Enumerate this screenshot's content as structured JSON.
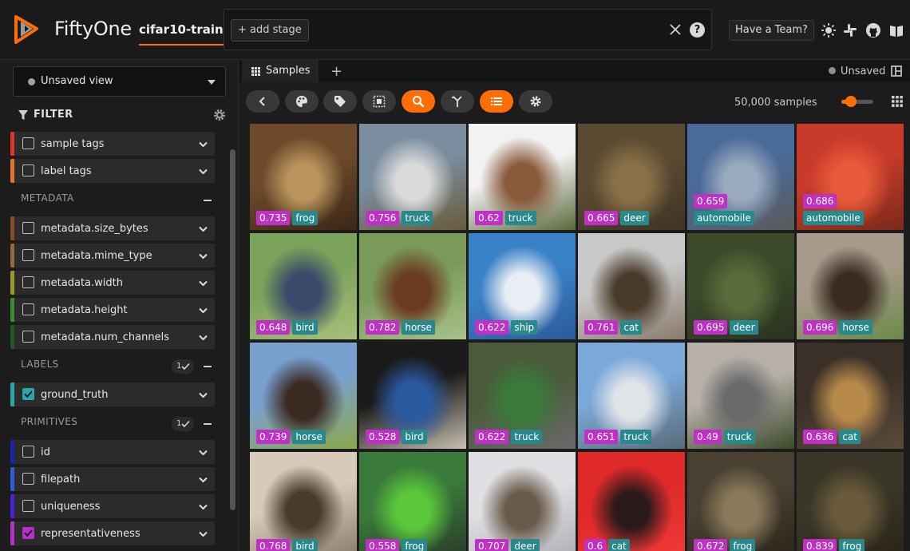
{
  "header": {
    "brand": "FiftyOne",
    "dataset": "cifar10-train",
    "add_stage": "+ add stage",
    "help": "?",
    "team_button": "Have a Team?",
    "icons": [
      "sun-icon",
      "slack-icon",
      "github-icon",
      "book-icon"
    ]
  },
  "sidebar": {
    "view_select": "Unsaved view",
    "filter_title": "FILTER",
    "sections": {
      "metadata": "METADATA",
      "labels": "LABELS",
      "labels_badge": "1",
      "primitives": "PRIMITIVES",
      "primitives_badge": "1"
    },
    "rows": [
      {
        "label": "sample tags",
        "color": "#e1352b",
        "checked": false
      },
      {
        "label": "label tags",
        "color": "#e8722b",
        "checked": false
      },
      {
        "label": "metadata.size_bytes",
        "color": "#8a4a22",
        "checked": false
      },
      {
        "label": "metadata.mime_type",
        "color": "#8e6a3c",
        "checked": false
      },
      {
        "label": "metadata.width",
        "color": "#9a9a26",
        "checked": false
      },
      {
        "label": "metadata.height",
        "color": "#3a8c2e",
        "checked": false
      },
      {
        "label": "metadata.num_channels",
        "color": "#1e5a22",
        "checked": false
      },
      {
        "label": "ground_truth",
        "color": "#2aa5a8",
        "checked": true
      },
      {
        "label": "id",
        "color": "#1a23b0",
        "checked": false
      },
      {
        "label": "filepath",
        "color": "#2d5ae0",
        "checked": false
      },
      {
        "label": "uniqueness",
        "color": "#4a22d8",
        "checked": false
      },
      {
        "label": "representativeness",
        "color": "#b530c8",
        "checked": true
      }
    ]
  },
  "tabs": {
    "samples": "Samples",
    "add": "+",
    "unsaved": "Unsaved"
  },
  "toolbar": {
    "count": "50,000 samples",
    "buttons": [
      "back-icon",
      "palette-icon",
      "tag-icon",
      "select-icon",
      "search-icon",
      "merge-icon",
      "list-icon",
      "gear-icon"
    ],
    "zoom_fraction": 0.2
  },
  "samples": [
    {
      "score": "0.735",
      "label": "frog",
      "c1": "#6e4a2c",
      "c2": "#b8935c",
      "c3": "#3a2616"
    },
    {
      "score": "0.756",
      "label": "truck",
      "c1": "#7a8ea0",
      "c2": "#dadada",
      "c3": "#6a5a3a"
    },
    {
      "score": "0.62",
      "label": "truck",
      "c1": "#f2f2f2",
      "c2": "#8a5a3c",
      "c3": "#5a6a3a"
    },
    {
      "score": "0.665",
      "label": "deer",
      "c1": "#5a4a32",
      "c2": "#8a7048",
      "c3": "#3e3424"
    },
    {
      "score": "0.659",
      "label": "automobile",
      "c1": "#4a6a9a",
      "c2": "#9aaac0",
      "c3": "#5a5a5a"
    },
    {
      "score": "0.686",
      "label": "automobile",
      "c1": "#c83a2a",
      "c2": "#e85a3a",
      "c3": "#7a2a1a"
    },
    {
      "score": "0.648",
      "label": "bird",
      "c1": "#7aa25a",
      "c2": "#3a4a6a",
      "c3": "#a8c07a"
    },
    {
      "score": "0.782",
      "label": "horse",
      "c1": "#7a9a5a",
      "c2": "#6a3a22",
      "c3": "#a8c28a"
    },
    {
      "score": "0.622",
      "label": "ship",
      "c1": "#3a82c8",
      "c2": "#e8eef4",
      "c3": "#2a5a9a"
    },
    {
      "score": "0.761",
      "label": "cat",
      "c1": "#c8c8c8",
      "c2": "#4a3a2a",
      "c3": "#8a7a6a"
    },
    {
      "score": "0.695",
      "label": "deer",
      "c1": "#3a4a2a",
      "c2": "#5a6a3a",
      "c3": "#2a3220"
    },
    {
      "score": "0.696",
      "label": "horse",
      "c1": "#a89a8a",
      "c2": "#3a2a22",
      "c3": "#6a8a4a"
    },
    {
      "score": "0.739",
      "label": "horse",
      "c1": "#7aa0d0",
      "c2": "#3a2a22",
      "c3": "#8aa84a"
    },
    {
      "score": "0.528",
      "label": "bird",
      "c1": "#1a1a1a",
      "c2": "#2a5aa0",
      "c3": "#c8c0b0"
    },
    {
      "score": "0.622",
      "label": "truck",
      "c1": "#4a5a3a",
      "c2": "#3a7a3a",
      "c3": "#6a6a6a"
    },
    {
      "score": "0.651",
      "label": "truck",
      "c1": "#7aa8d8",
      "c2": "#e0e4e8",
      "c3": "#5a6a7a"
    },
    {
      "score": "0.49",
      "label": "truck",
      "c1": "#b8b0a8",
      "c2": "#6a6a6a",
      "c3": "#3a4a2a"
    },
    {
      "score": "0.636",
      "label": "cat",
      "c1": "#3a3028",
      "c2": "#b88a4a",
      "c3": "#5a4a3a"
    },
    {
      "score": "0.768",
      "label": "bird",
      "c1": "#d8cab8",
      "c2": "#4a3a2a",
      "c3": "#8a7a6a"
    },
    {
      "score": "0.558",
      "label": "frog",
      "c1": "#3a7a3a",
      "c2": "#5ac83a",
      "c3": "#2a3a2a"
    },
    {
      "score": "0.707",
      "label": "deer",
      "c1": "#e0e0e4",
      "c2": "#6a5a4a",
      "c3": "#b0b0b4"
    },
    {
      "score": "0.6",
      "label": "cat",
      "c1": "#e02a2a",
      "c2": "#2a1a1a",
      "c3": "#f03a3a"
    },
    {
      "score": "0.672",
      "label": "frog",
      "c1": "#4a4032",
      "c2": "#8a7a5a",
      "c3": "#2a241a"
    },
    {
      "score": "0.839",
      "label": "frog",
      "c1": "#3a3628",
      "c2": "#6a5a3a",
      "c3": "#2a2418"
    }
  ]
}
